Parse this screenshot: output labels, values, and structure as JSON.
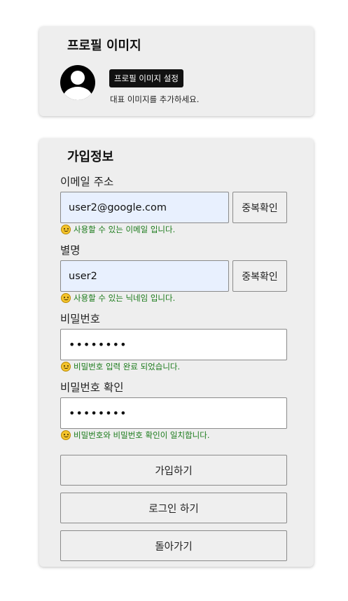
{
  "profile": {
    "title": "프로필 이미지",
    "set_image_button": "프로필 이미지 설정",
    "hint": "대표 이미지를 추가하세요."
  },
  "signup": {
    "title": "가입정보",
    "email": {
      "label": "이메일 주소",
      "value": "user2@google.com",
      "check_button": "중복확인",
      "message": "사용할 수 있는 이메일 입니다."
    },
    "nickname": {
      "label": "별명",
      "value": "user2",
      "check_button": "중복확인",
      "message": "사용할 수 있는 닉네임 입니다."
    },
    "password": {
      "label": "비밀번호",
      "value": "••••••••",
      "message": "비밀번호 입력 완료 되었습니다."
    },
    "password_confirm": {
      "label": "비밀번호 확인",
      "value": "••••••••",
      "message": "비밀번호와 비밀번호 확인이 일치합니다."
    },
    "buttons": {
      "signup": "가입하기",
      "login": "로그인 하기",
      "back": "돌아가기"
    }
  },
  "colors": {
    "card_bg": "#eeeeee",
    "autofill_bg": "#e8f0fe",
    "success_text": "#1a7a1a",
    "image_button_bg": "#111111"
  },
  "icons": {
    "avatar": "default-avatar-icon",
    "status": "smiley-icon"
  }
}
